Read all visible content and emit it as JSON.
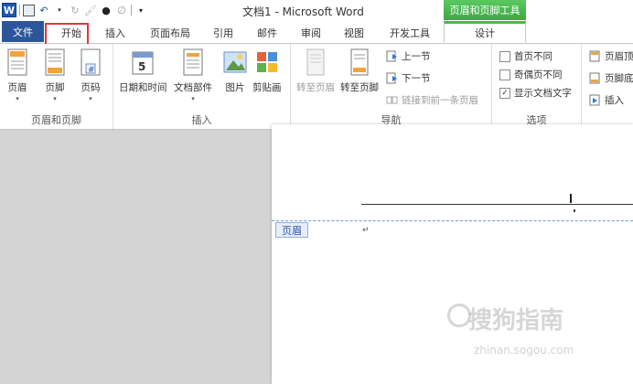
{
  "window": {
    "title": "文档1 - Microsoft Word",
    "context_tab_title": "页眉和页脚工具"
  },
  "tabs": [
    {
      "label": "文件"
    },
    {
      "label": "开始"
    },
    {
      "label": "插入"
    },
    {
      "label": "页面布局"
    },
    {
      "label": "引用"
    },
    {
      "label": "邮件"
    },
    {
      "label": "审阅"
    },
    {
      "label": "视图"
    },
    {
      "label": "开发工具"
    },
    {
      "label": "设计"
    }
  ],
  "ribbon": {
    "group_header_footer": {
      "label": "页眉和页脚",
      "header": "页眉",
      "footer": "页脚",
      "page_number": "页码"
    },
    "group_insert": {
      "label": "插入",
      "datetime": "日期和时间",
      "quickparts": "文档部件",
      "picture": "图片",
      "clipart": "剪贴画"
    },
    "group_nav": {
      "label": "导航",
      "goto_header": "转至页眉",
      "goto_footer": "转至页脚",
      "prev_section": "上一节",
      "next_section": "下一节",
      "link_prev": "链接到前一条页眉"
    },
    "group_options": {
      "label": "选项",
      "diff_first": "首页不同",
      "diff_odd_even": "奇偶页不同",
      "show_text": "显示文档文字",
      "show_text_checked": true
    },
    "group_position": {
      "header_top": "页眉顶",
      "footer_bottom": "页脚底",
      "insert": "插入"
    }
  },
  "document": {
    "header_tag": "页眉",
    "para_mark": "↵"
  },
  "watermark": {
    "text": "搜狗指南",
    "sub": "zhinan.sogou.com"
  },
  "colors": {
    "file_tab": "#2b579a",
    "context_green": "#4fb54e",
    "highlight_box": "#e0373a"
  }
}
